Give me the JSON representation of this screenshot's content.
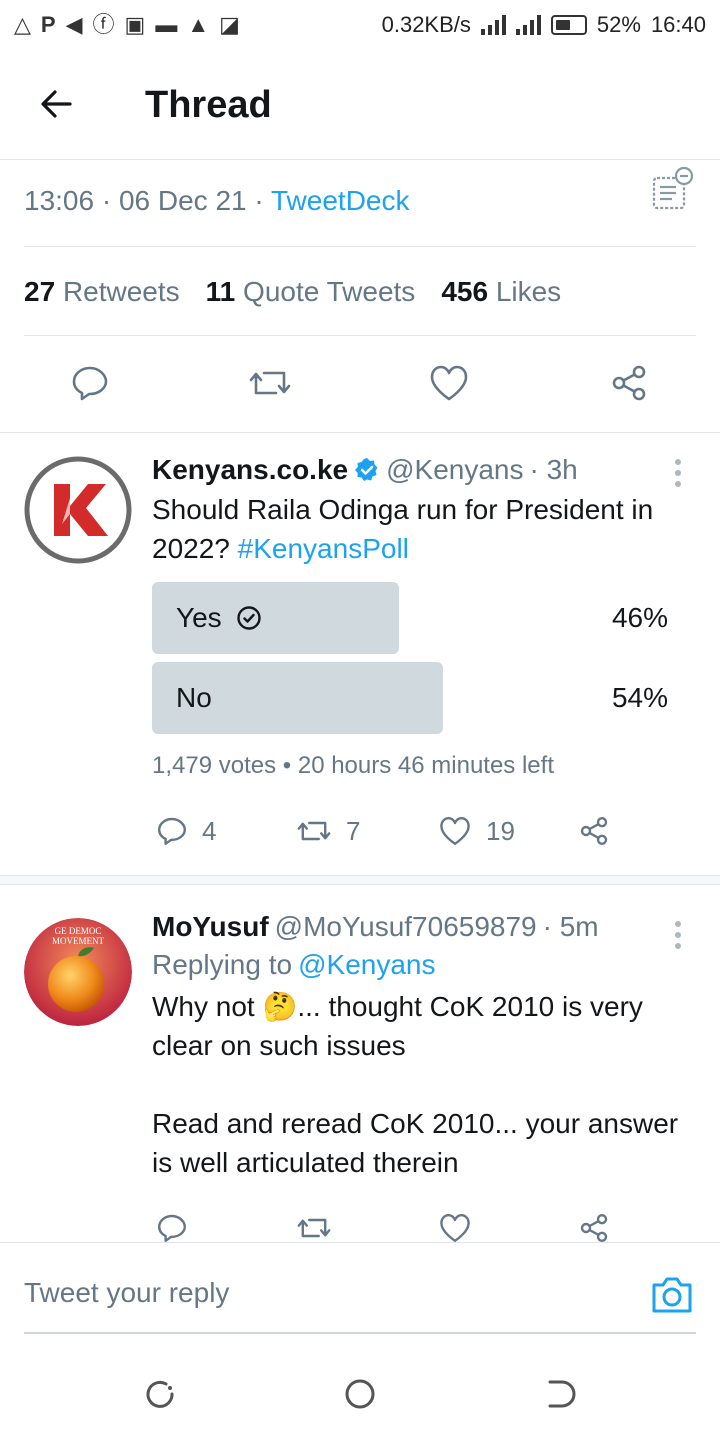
{
  "status_bar": {
    "net_speed": "0.32KB/s",
    "battery": "52%",
    "time": "16:40",
    "left_icons": [
      "warning-icon",
      "p-icon",
      "telegram-icon",
      "facebook-icon",
      "download-icon",
      "message-icon",
      "alert-icon",
      "image-icon"
    ]
  },
  "header": {
    "title": "Thread"
  },
  "main_tweet_meta": {
    "time": "13:06",
    "date": "06 Dec 21",
    "source": "TweetDeck",
    "separator": "·"
  },
  "main_tweet_stats": {
    "retweets_count": "27",
    "retweets_label": "Retweets",
    "quotes_count": "11",
    "quotes_label": "Quote Tweets",
    "likes_count": "456",
    "likes_label": "Likes"
  },
  "poll_tweet": {
    "name": "Kenyans.co.ke",
    "handle": "@Kenyans",
    "time": "· 3h",
    "text": "Should Raila Odinga run for President in 2022?",
    "hashtag": "#KenyansPoll",
    "poll": {
      "options": [
        {
          "label": "Yes",
          "percent_text": "46%",
          "fraction": 0.46,
          "selected": true
        },
        {
          "label": "No",
          "percent_text": "54%",
          "fraction": 0.54,
          "selected": false
        }
      ],
      "votes": "1,479 votes",
      "dot": "•",
      "time_left": "20 hours 46 minutes left"
    },
    "replies": "4",
    "retweets": "7",
    "likes": "19"
  },
  "reply_tweet": {
    "name": "MoYusuf",
    "handle": "@MoYusuf70659879",
    "time": "· 5m",
    "replying_to_label": "Replying to",
    "replying_to_handle": "@Kenyans",
    "text_part1": "Why not",
    "emoji": "🤔",
    "text_part2": "... thought CoK 2010 is very clear on such issues",
    "text_part3": "Read and reread CoK 2010... your answer is well articulated therein",
    "avatar_text": "GE DEMOC MOVEMENT"
  },
  "reply_bar": {
    "placeholder": "Tweet your reply"
  },
  "colors": {
    "accent": "#1da1f2",
    "secondary_text": "#657786",
    "poll_fill": "#d0d9de",
    "brand_red": "#d32a2a"
  }
}
